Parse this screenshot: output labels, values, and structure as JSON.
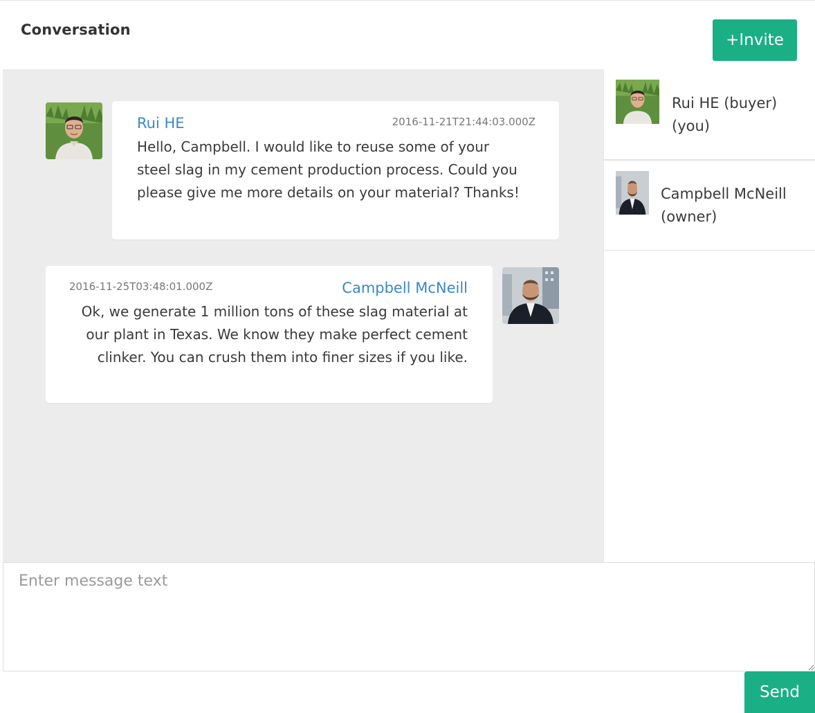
{
  "header": {
    "title": "Conversation",
    "invite_label": "+Invite"
  },
  "messages": [
    {
      "sender": "Rui HE",
      "timestamp": "2016-11-21T21:44:03.000Z",
      "text": "Hello, Campbell. I would like to reuse some of your steel slag in my cement production process. Could you please give me more details on your material? Thanks!",
      "avatar": "rui-he-avatar"
    },
    {
      "sender": "Campbell McNeill",
      "timestamp": "2016-11-25T03:48:01.000Z",
      "text": "Ok, we generate 1 million tons of these slag material at our plant in Texas. We know they make perfect cement clinker. You can crush them into finer sizes if you like.",
      "avatar": "campbell-mcneill-avatar"
    }
  ],
  "participants": [
    {
      "name_line1": "Rui HE (buyer)",
      "name_line2": "(you)"
    },
    {
      "name_line1": "Campbell McNeill",
      "name_line2": "(owner)"
    }
  ],
  "compose": {
    "placeholder": "Enter message text",
    "value": "",
    "send_label": "Send"
  },
  "colors": {
    "accent": "#1aaf84",
    "sender_name": "#3a87c8",
    "pane_background": "#ececec"
  }
}
